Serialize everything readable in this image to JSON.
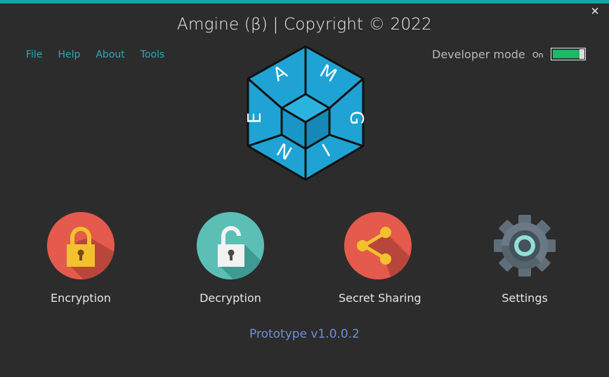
{
  "window": {
    "title": "Amgine (β) | Copyright © 2022",
    "close_glyph": "✕",
    "accent_color": "#1aa3a3"
  },
  "menu": {
    "items": [
      {
        "label": "File"
      },
      {
        "label": "Help"
      },
      {
        "label": "About"
      },
      {
        "label": "Tools"
      }
    ]
  },
  "developer_mode": {
    "label": "Developer mode",
    "state_label": "On",
    "enabled": true,
    "toggle_color": "#1fb866"
  },
  "logo": {
    "letters": [
      "A",
      "M",
      "G",
      "I",
      "N",
      "E"
    ],
    "color": "#1fa3d4"
  },
  "actions": [
    {
      "label": "Encryption",
      "icon": "lock-icon"
    },
    {
      "label": "Decryption",
      "icon": "unlock-icon"
    },
    {
      "label": "Secret Sharing",
      "icon": "share-icon"
    },
    {
      "label": "Settings",
      "icon": "gear-icon"
    }
  ],
  "footer": {
    "version": "Prototype v1.0.0.2"
  }
}
